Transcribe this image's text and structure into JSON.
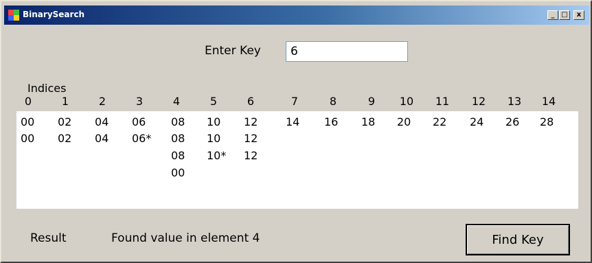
{
  "window": {
    "title": "BinarySearch",
    "controls": {
      "minimize": "_",
      "maximize": "□",
      "close": "x"
    }
  },
  "search": {
    "key_label": "Enter Key",
    "key_value": "6"
  },
  "indices": {
    "label": "Indices",
    "values": [
      "0",
      "1",
      "2",
      "3",
      "4",
      "5",
      "6",
      "7",
      "8",
      "9",
      "10",
      "11",
      "12",
      "13",
      "14"
    ]
  },
  "array": {
    "row1": [
      "00",
      "02",
      "04",
      "06",
      "08",
      "10",
      "12",
      "14",
      "16",
      "18",
      "20",
      "22",
      "24",
      "26",
      "28"
    ],
    "row2": [
      "00",
      "02",
      "04",
      "06*",
      "08",
      "10",
      "12"
    ],
    "row3": [
      "08",
      "10*",
      "12"
    ],
    "row4": [
      "00"
    ]
  },
  "result": {
    "label": "Result",
    "text": "Found value in element 4"
  },
  "buttons": {
    "find_key": "Find Key"
  }
}
